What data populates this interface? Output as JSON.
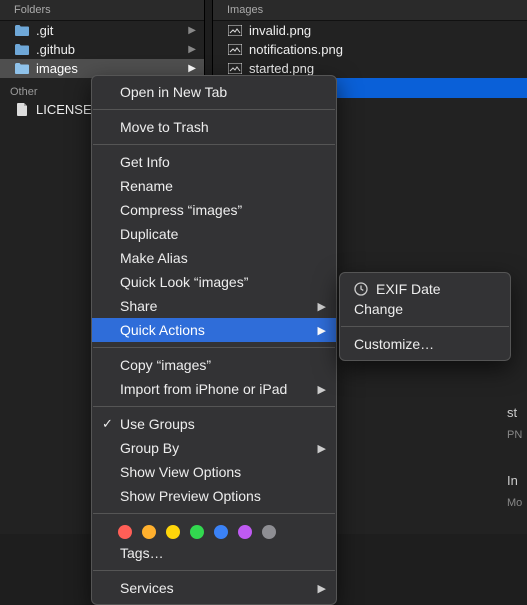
{
  "left": {
    "header": "Folders",
    "items": [
      {
        "label": ".git"
      },
      {
        "label": ".github"
      },
      {
        "label": "images"
      }
    ],
    "otherHeader": "Other",
    "other": [
      {
        "label": "LICENSE"
      }
    ]
  },
  "right": {
    "header": "Images",
    "items": [
      {
        "label": "invalid.png"
      },
      {
        "label": "notifications.png"
      },
      {
        "label": "started.png"
      }
    ]
  },
  "menu": {
    "openNewTab": "Open in New Tab",
    "moveToTrash": "Move to Trash",
    "getInfo": "Get Info",
    "rename": "Rename",
    "compress": "Compress “images”",
    "duplicate": "Duplicate",
    "makeAlias": "Make Alias",
    "quickLook": "Quick Look “images”",
    "share": "Share",
    "quickActions": "Quick Actions",
    "copy": "Copy “images”",
    "import": "Import from iPhone or iPad",
    "useGroups": "Use Groups",
    "groupBy": "Group By",
    "showViewOptions": "Show View Options",
    "showPreviewOptions": "Show Preview Options",
    "tags": "Tags…",
    "services": "Services",
    "tagColors": [
      "#ff5f57",
      "#ffb02e",
      "#ffd60a",
      "#32d84f",
      "#3b82f6",
      "#bf5af2",
      "#8e8e93"
    ]
  },
  "submenu": {
    "exif": "EXIF Date Change",
    "customize": "Customize…"
  },
  "info": {
    "l1": "st",
    "l2": "PN",
    "l3": "In",
    "l4": "Mo"
  }
}
